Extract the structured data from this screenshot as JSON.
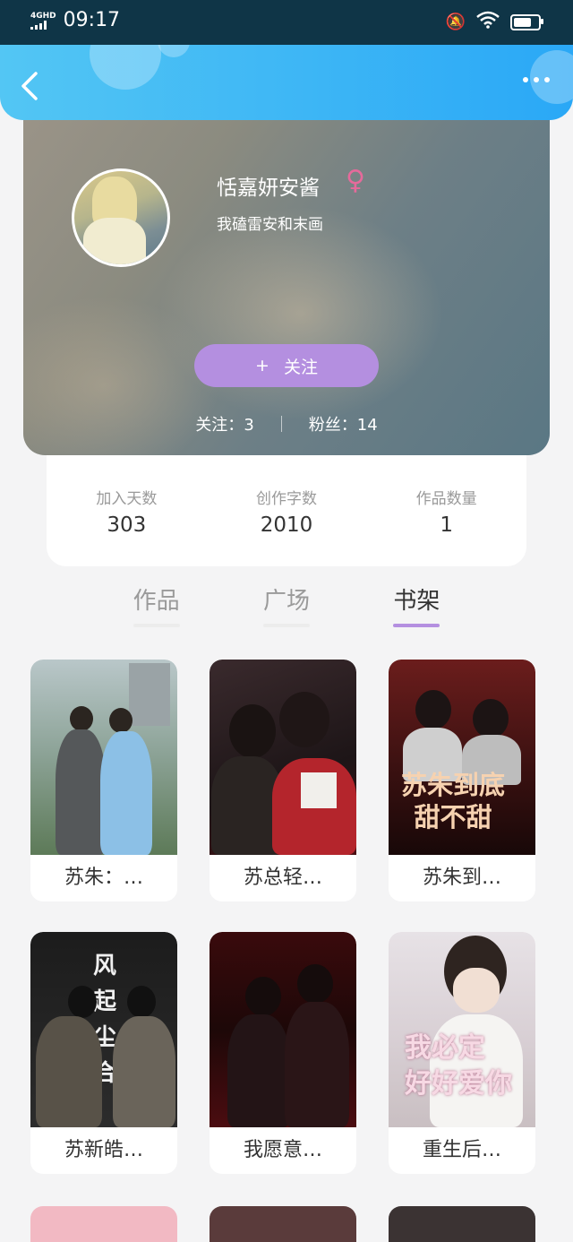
{
  "status_bar": {
    "network": "4GHD",
    "time": "09:17",
    "battery_level": 0.85
  },
  "header": {
    "back_icon": "chevron-left-icon",
    "more_icon": "more-dots-icon"
  },
  "profile": {
    "name": "恬嘉妍安酱",
    "gender_symbol": "♀",
    "gender_color": "#e66a9b",
    "signature": "我磕雷安和末画",
    "follow_button": {
      "icon": "+",
      "label": "关注",
      "color": "#b48fe0"
    },
    "following_label": "关注：",
    "following_count": "3",
    "fans_label": "粉丝：",
    "fans_count": "14"
  },
  "stats": [
    {
      "label": "加入天数",
      "value": "303"
    },
    {
      "label": "创作字数",
      "value": "2010"
    },
    {
      "label": "作品数量",
      "value": "1"
    }
  ],
  "tabs": [
    {
      "label": "作品",
      "active": false
    },
    {
      "label": "广场",
      "active": false
    },
    {
      "label": "书架",
      "active": true
    }
  ],
  "books": [
    {
      "caption": "苏朱：…"
    },
    {
      "caption": "苏总轻…"
    },
    {
      "caption": "苏朱到…",
      "cover_text": "苏朱到底\n甜不甜"
    },
    {
      "caption": "苏新皓…",
      "cover_text": "风\n起\n尘\n合"
    },
    {
      "caption": "我愿意…"
    },
    {
      "caption": "重生后…",
      "cover_text": "我必定\n好好爱你"
    }
  ],
  "colors": {
    "header_start": "#53c6f4",
    "header_end": "#2aa8f6",
    "accent": "#b48fe0",
    "page_bg": "#f4f4f5"
  }
}
